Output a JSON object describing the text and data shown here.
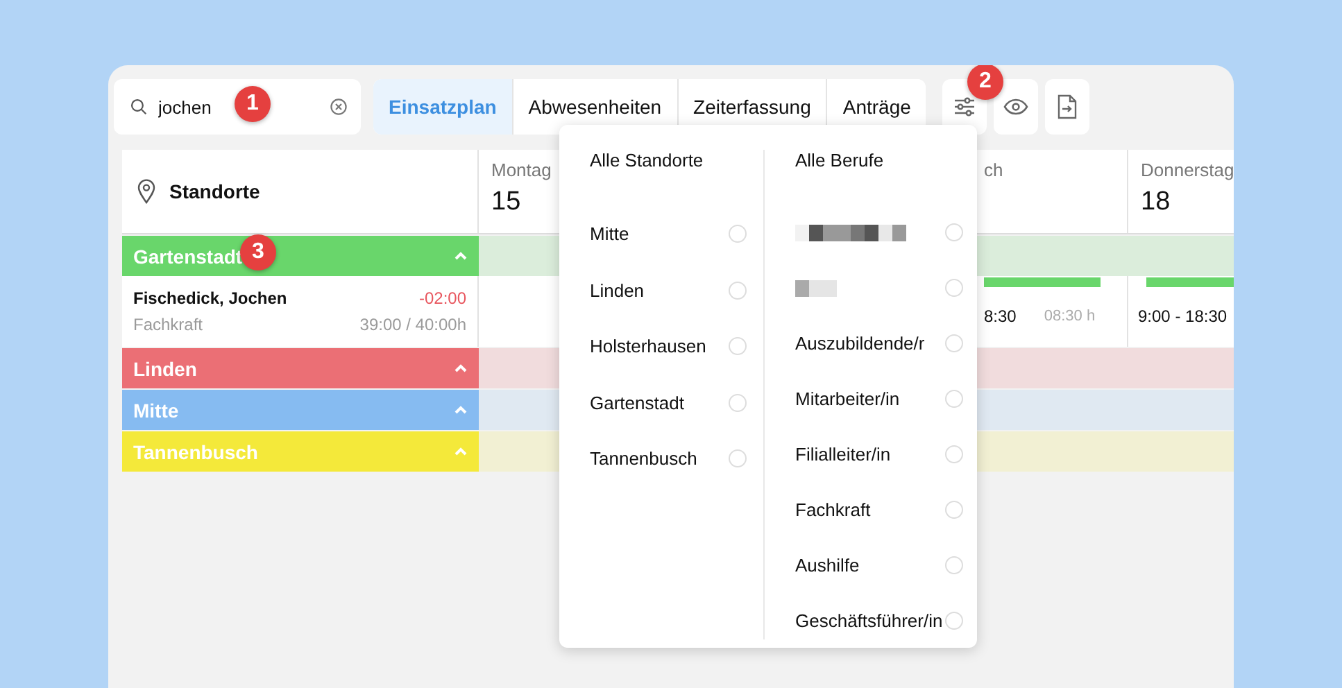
{
  "search": {
    "value": "jochen"
  },
  "tabs": [
    {
      "label": "Einsatzplan",
      "selected": true
    },
    {
      "label": "Abwesenheiten",
      "selected": false
    },
    {
      "label": "Zeiterfassung",
      "selected": false
    },
    {
      "label": "Anträge",
      "selected": false
    }
  ],
  "grid": {
    "header": "Standorte",
    "days": [
      {
        "kind": "full",
        "weekday": "Montag",
        "date": "15"
      },
      {
        "kind": "cut",
        "weekday": "ch"
      },
      {
        "kind": "full",
        "weekday": "Donnerstag",
        "date": "18"
      }
    ],
    "groups": [
      {
        "name": "Gartenstadt",
        "color": "#69d66b",
        "expanded": true,
        "employees": [
          {
            "name": "Fischedick, Jochen",
            "balance": "-02:00",
            "role": "Fachkraft",
            "hours": "39:00 / 40:00h",
            "cells": [
              {
                "kind": "empty"
              },
              {
                "kind": "shift",
                "time": "8:30",
                "duration": "08:30 h"
              },
              {
                "kind": "shift",
                "time": "9:00 - 18:30"
              }
            ]
          }
        ]
      },
      {
        "name": "Linden",
        "color": "#eb6f75",
        "expanded": true
      },
      {
        "name": "Mitte",
        "color": "#86bbf1",
        "expanded": true
      },
      {
        "name": "Tannenbusch",
        "color": "#f4e93a",
        "expanded": true
      }
    ]
  },
  "filter_menu": {
    "locations": {
      "header": "Alle Standorte",
      "items": [
        {
          "label": "Mitte",
          "selected": false
        },
        {
          "label": "Linden",
          "selected": false
        },
        {
          "label": "Holsterhausen",
          "selected": false
        },
        {
          "label": "Gartenstadt",
          "selected": false
        },
        {
          "label": "Tannenbusch",
          "selected": false
        }
      ]
    },
    "professions": {
      "header": "Alle Berufe",
      "items": [
        {
          "kind": "redacted",
          "selected": false
        },
        {
          "kind": "redacted",
          "selected": false
        },
        {
          "kind": "text",
          "label": "Auszubildende/r",
          "selected": false
        },
        {
          "kind": "text",
          "label": "Mitarbeiter/in",
          "selected": false
        },
        {
          "kind": "text",
          "label": "Filialleiter/in",
          "selected": false
        },
        {
          "kind": "text",
          "label": "Fachkraft",
          "selected": false
        },
        {
          "kind": "text",
          "label": "Aushilfe",
          "selected": false
        },
        {
          "kind": "text",
          "label": "Geschäftsführer/in",
          "selected": false
        }
      ]
    }
  },
  "markers": [
    "1",
    "2",
    "3"
  ]
}
